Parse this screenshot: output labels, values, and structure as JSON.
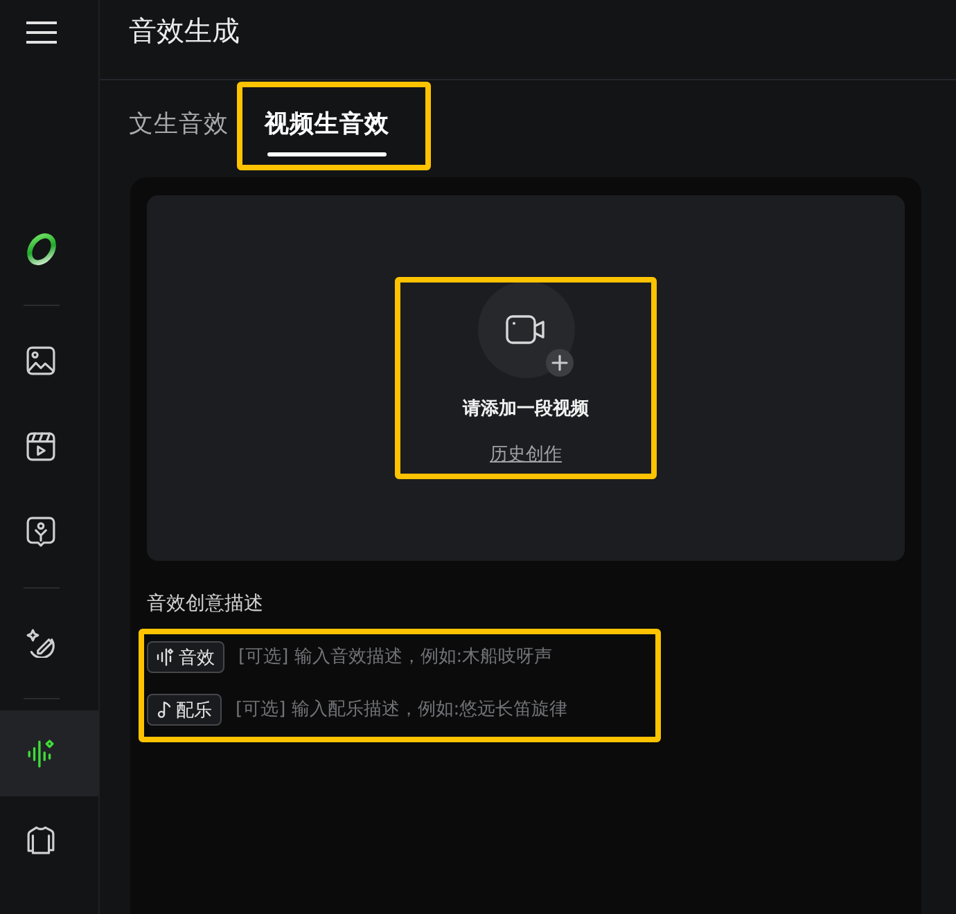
{
  "sidebar": {
    "groups": [
      [
        {
          "kind": "logo",
          "selected": false
        }
      ],
      [
        {
          "kind": "image",
          "selected": false
        },
        {
          "kind": "video",
          "selected": false
        },
        {
          "kind": "avatar",
          "selected": false
        }
      ],
      [
        {
          "kind": "magic",
          "selected": false
        }
      ],
      [
        {
          "kind": "audio",
          "selected": true
        },
        {
          "kind": "apparel",
          "selected": false
        }
      ]
    ]
  },
  "header": {
    "title": "音效生成"
  },
  "tabs": [
    {
      "label": "文生音效",
      "selected": false,
      "highlighted": false
    },
    {
      "label": "视频生音效",
      "selected": true,
      "highlighted": true
    }
  ],
  "upload": {
    "prompt": "请添加一段视频",
    "history_link": "历史创作",
    "highlighted": true
  },
  "description": {
    "label": "音效创意描述",
    "rows_highlighted": true,
    "rows": [
      {
        "kind": "sound",
        "tag": "音效",
        "placeholder": "[可选] 输入音效描述，例如:木船吱呀声"
      },
      {
        "kind": "music",
        "tag": "配乐",
        "placeholder": "[可选] 输入配乐描述，例如:悠远长笛旋律"
      }
    ]
  }
}
